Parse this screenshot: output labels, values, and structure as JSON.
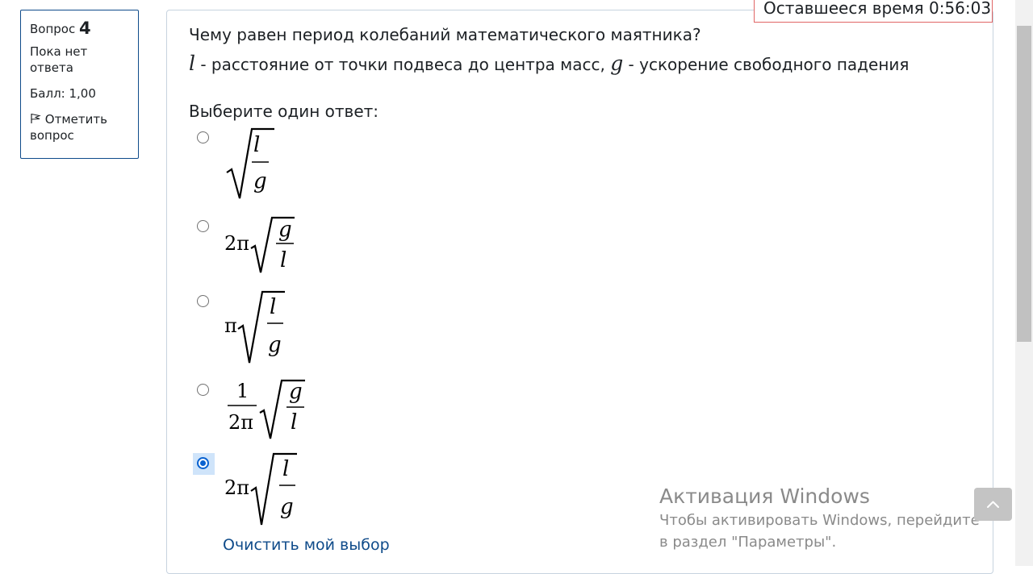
{
  "info": {
    "question_label": "Вопрос",
    "question_number": "4",
    "state": "Пока нет ответа",
    "grade": "Балл: 1,00",
    "flag_label": "Отметить вопрос"
  },
  "timer": {
    "text": "Оставшееся время 0:56:03"
  },
  "question": {
    "text": "Чему равен период колебаний математического маятника?",
    "var_l": "l",
    "desc_l": " - расстояние от точки подвеса до центра масс, ",
    "var_g": "g",
    "desc_g": " - ускорение свободного падения",
    "prompt": "Выберите один ответ:"
  },
  "answers": [
    {
      "formula": "√(l/g)",
      "selected": false
    },
    {
      "formula": "2π√(g/l)",
      "selected": false
    },
    {
      "formula": "π√(l/g)",
      "selected": false
    },
    {
      "formula": "(1/2π)√(g/l)",
      "selected": false
    },
    {
      "formula": "2π√(l/g)",
      "selected": true
    }
  ],
  "math": {
    "two_pi": "2π",
    "pi": "π",
    "one": "1",
    "l": "l",
    "g": "g"
  },
  "clear_choice": "Очистить мой выбор",
  "watermark": {
    "title": "Активация Windows",
    "text": "Чтобы активировать Windows, перейдите в раздел \"Параметры\"."
  },
  "icons": {
    "flag": "flag-outline-icon",
    "back_to_top": "chevron-up-icon"
  }
}
